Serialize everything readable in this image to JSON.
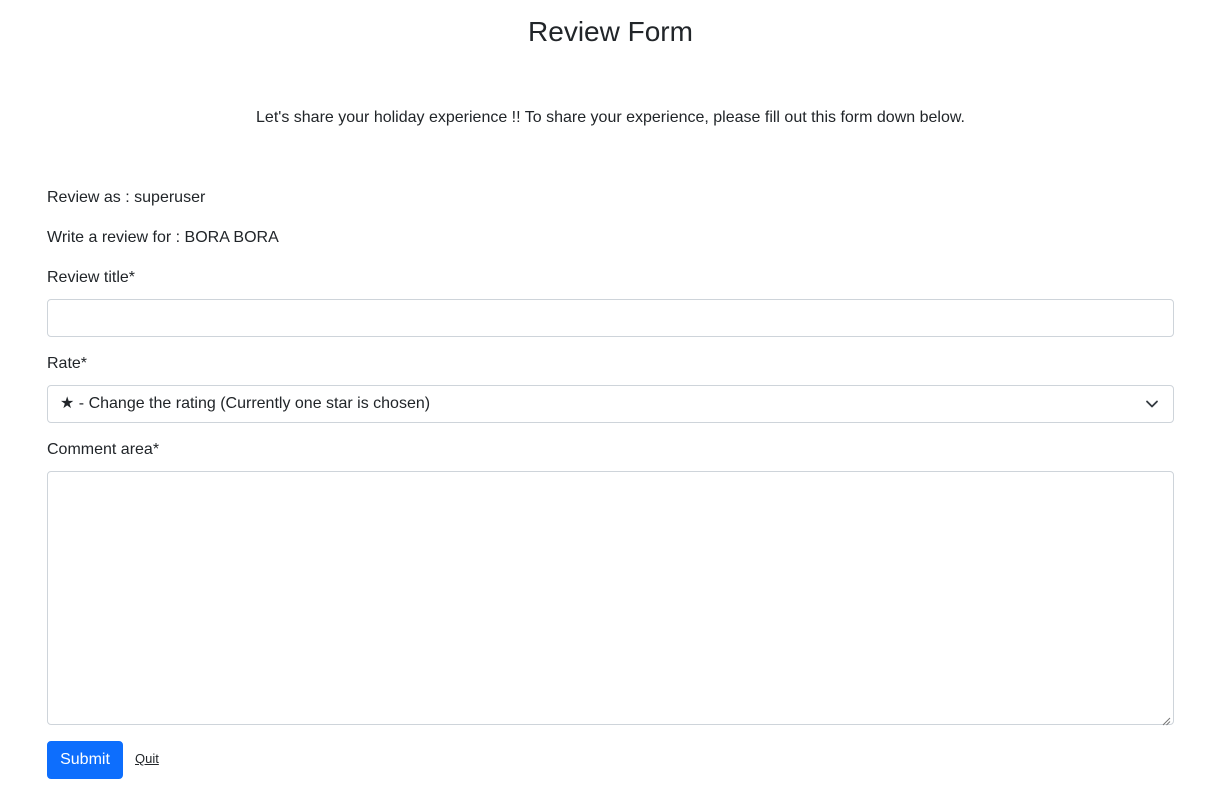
{
  "header": {
    "title": "Review Form",
    "intro": "Let's share your holiday experience !! To share your experience, please fill out this form down below."
  },
  "form": {
    "review_as": "Review as : superuser",
    "review_for": "Write a review for : BORA BORA",
    "title_label": "Review title*",
    "title_value": "",
    "rate_label": "Rate*",
    "rate_selected": "★ - Change the rating (Currently one star is chosen)",
    "comment_label": "Comment area*",
    "comment_value": "",
    "submit_label": "Submit",
    "quit_label": "Quit"
  },
  "icons": {
    "select_arrow": "chevron-down-icon",
    "textarea_grip": "resize-grip-icon"
  },
  "colors": {
    "primary": "#0d6efd",
    "text": "#212529",
    "border": "#ced4da"
  }
}
